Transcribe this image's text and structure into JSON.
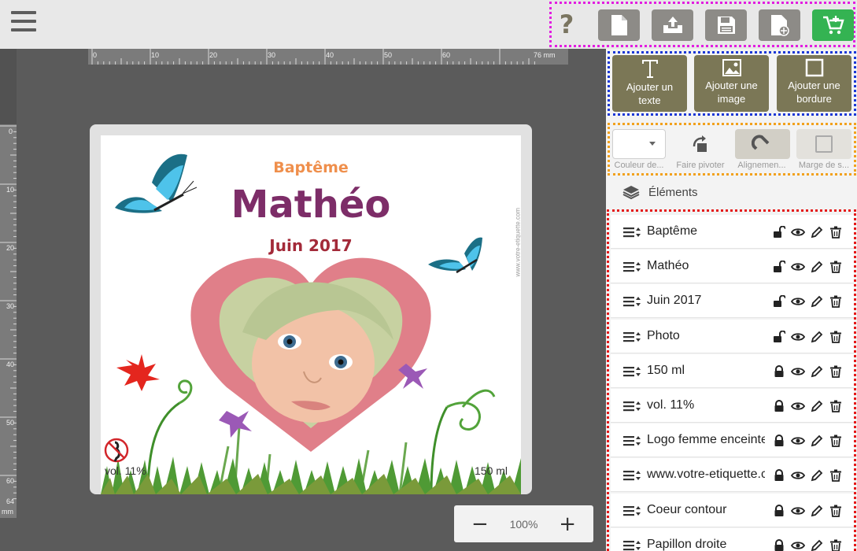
{
  "toolbar": {
    "help_label": "?",
    "buttons": [
      "new-document",
      "export",
      "save",
      "add-page",
      "cart"
    ],
    "cart_color": "#34b352",
    "button_color": "#8d8b87"
  },
  "ruler": {
    "top_ticks": [
      "0",
      "10",
      "20",
      "30",
      "40",
      "50",
      "60"
    ],
    "top_unit": "76 mm",
    "left_ticks": [
      "0",
      "10",
      "20",
      "30",
      "40",
      "50",
      "60"
    ],
    "left_end": "64",
    "left_unit": "mm"
  },
  "label": {
    "title": "Baptême",
    "name": "Mathéo",
    "date": "Juin 2017",
    "watermark": "www.votre-etiquette.com",
    "vol": "vol. 11%",
    "volume": "150 ml"
  },
  "zoom": {
    "minus": "−",
    "value": "100%",
    "plus": "+"
  },
  "add_panel": [
    {
      "line1": "Ajouter un",
      "line2": "texte"
    },
    {
      "line1": "Ajouter une",
      "line2": "image"
    },
    {
      "line1": "Ajouter une",
      "line2": "bordure"
    }
  ],
  "props": {
    "color_label": "Couleur de...",
    "rotate_label": "Faire pivoter",
    "align_label": "Alignemen...",
    "margin_label": "Marge de s..."
  },
  "elements": {
    "header": "Éléments",
    "items": [
      {
        "label": "Baptême",
        "locked": false
      },
      {
        "label": "Mathéo",
        "locked": false
      },
      {
        "label": "Juin 2017",
        "locked": false
      },
      {
        "label": "Photo",
        "locked": false
      },
      {
        "label": "150 ml",
        "locked": true
      },
      {
        "label": "vol. 11%",
        "locked": true
      },
      {
        "label": "Logo femme enceinte",
        "locked": true
      },
      {
        "label": "www.votre-etiquette.com",
        "locked": true
      },
      {
        "label": "Coeur contour",
        "locked": true
      },
      {
        "label": "Papillon droite",
        "locked": true
      }
    ]
  }
}
